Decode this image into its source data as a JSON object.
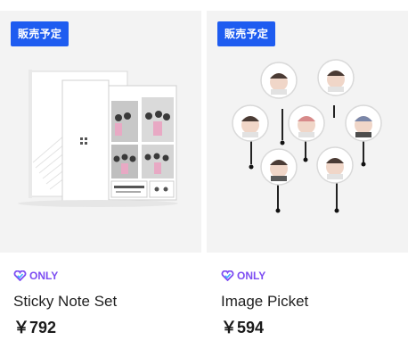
{
  "products": [
    {
      "badge": "販売予定",
      "tag": "ONLY",
      "name": "Sticky Note Set",
      "price": "￥792",
      "image_icon": "sticky-note-set-photo"
    },
    {
      "badge": "販売予定",
      "tag": "ONLY",
      "name": "Image Picket",
      "price": "￥594",
      "image_icon": "image-picket-photo"
    }
  ],
  "colors": {
    "badge_bg": "#1e5cf0",
    "only_purple": "#7d4df2",
    "thumb_bg": "#f3f3f3"
  }
}
